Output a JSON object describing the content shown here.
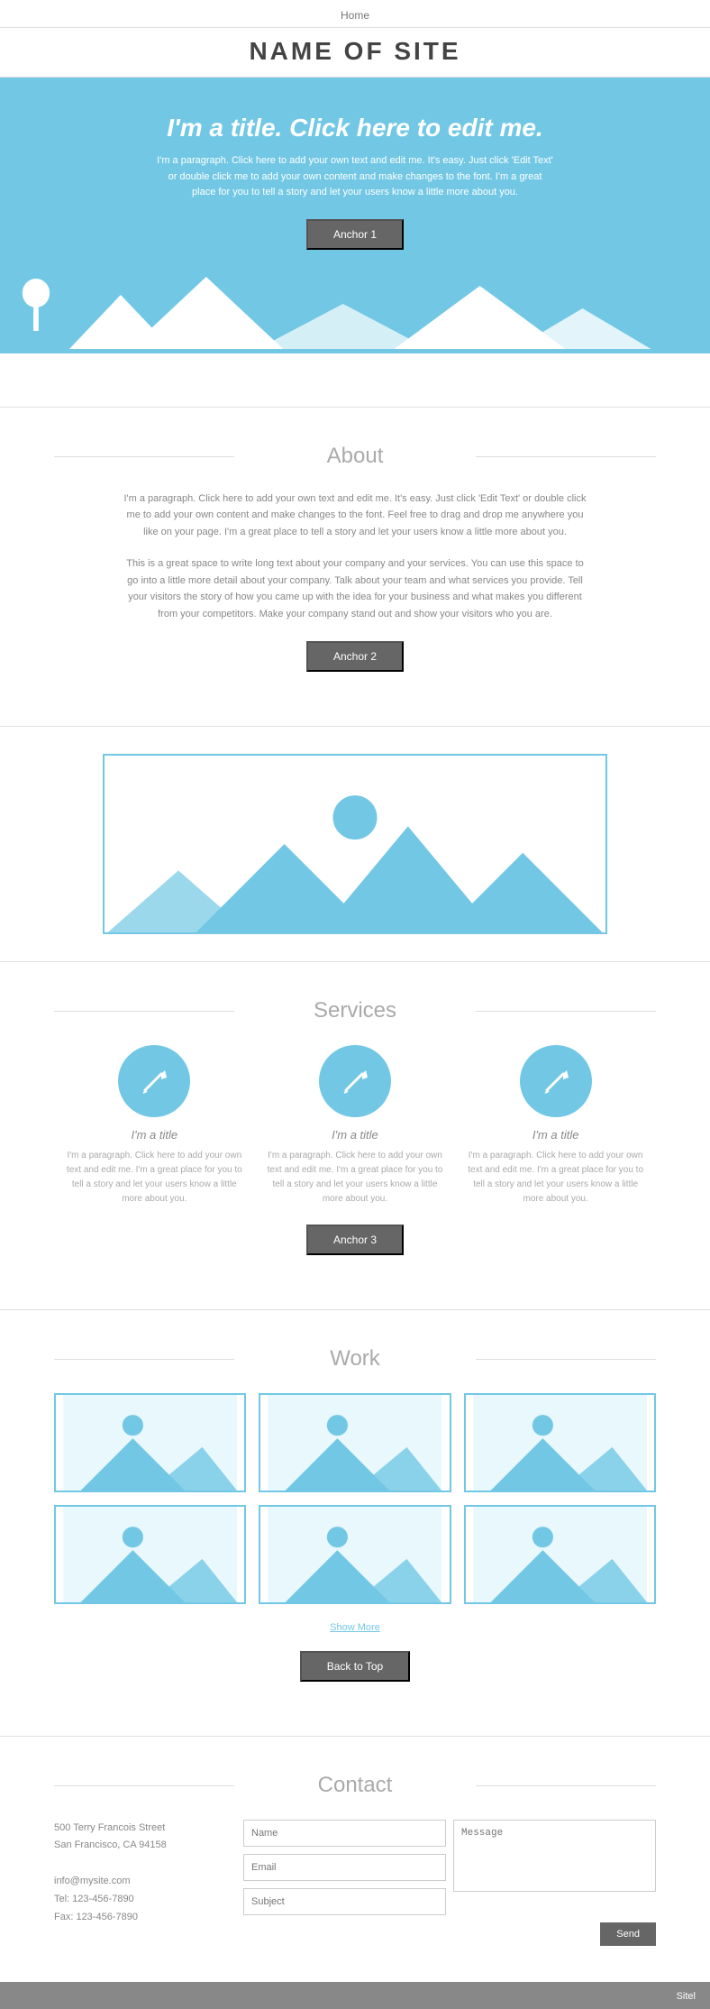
{
  "nav": {
    "home_label": "Home"
  },
  "site": {
    "title": "NAME OF SITE"
  },
  "hero": {
    "heading": "I'm a title. Click here to edit me.",
    "paragraph": "I'm a paragraph. Click here to add your own text and edit me. It's easy. Just click 'Edit Text' or double click me to add your own content and make changes to the font. I'm a great place for you to tell a story and let your users know a little more about you.",
    "anchor_label": "Anchor 1"
  },
  "about": {
    "section_title": "About",
    "paragraph1": "I'm a paragraph. Click here to add your own text and edit me. It's easy. Just click 'Edit Text' or double click me to add your own content and make changes to the font. Feel free to drag and drop me anywhere you like on your page. I'm a great place to tell a story and let your users know a little more about you.",
    "paragraph2": "This is a great space to write long text about your company and your services. You can use this space to go into a little more detail about your company. Talk about your team and what services you provide. Tell your visitors the story of how you came up with the idea for your business and what makes you different from your competitors. Make your company stand out and show your visitors who you are.",
    "anchor_label": "Anchor 2"
  },
  "services": {
    "section_title": "Services",
    "items": [
      {
        "title": "I'm a title",
        "text": "I'm a paragraph. Click here to add your own text and edit me. I'm a great place for you to tell a story and let your users know a little more about you."
      },
      {
        "title": "I'm a title",
        "text": "I'm a paragraph. Click here to add your own text and edit me. I'm a great place for you to tell a story and let your users know a little more about you."
      },
      {
        "title": "I'm a title",
        "text": "I'm a paragraph. Click here to add your own text and edit me. I'm a great place for you to tell a story and let your users know a little more about you."
      }
    ],
    "anchor_label": "Anchor 3"
  },
  "work": {
    "section_title": "Work",
    "show_more": "Show More",
    "back_to_top": "Back to Top"
  },
  "contact": {
    "section_title": "Contact",
    "address_line1": "500 Terry Francois Street",
    "address_line2": "San Francisco, CA  94158",
    "email": "info@mysite.com",
    "tel": "Tel: 123-456-7890",
    "fax": "Fax: 123-456-7890",
    "form": {
      "name_placeholder": "Name",
      "email_placeholder": "Email",
      "subject_placeholder": "Subject",
      "message_placeholder": "Message",
      "send_label": "Send"
    }
  },
  "footer": {
    "brand": "Sitel"
  }
}
